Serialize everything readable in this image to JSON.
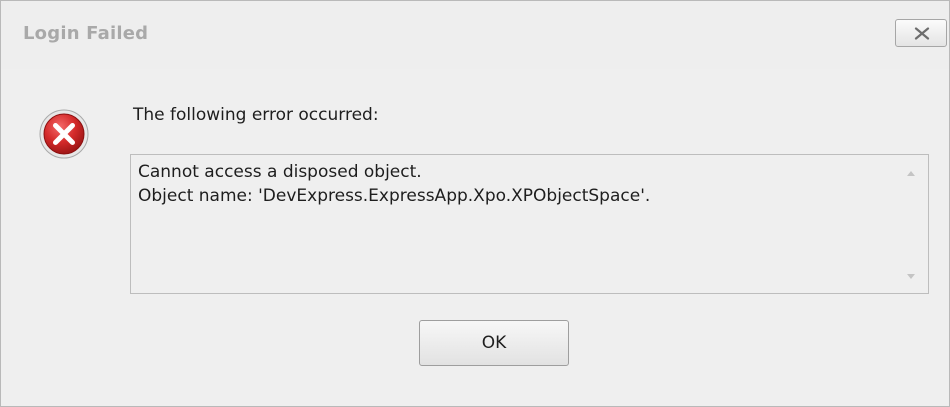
{
  "dialog": {
    "title": "Login Failed",
    "close_label": "x",
    "message": "The following error occurred:",
    "details": [
      "Cannot access a disposed object.",
      "Object name: 'DevExpress.ExpressApp.Xpo.XPObjectSpace'."
    ],
    "ok_label": "OK",
    "icon": "error-icon"
  },
  "colors": {
    "window_bg": "#efefef",
    "title_text": "#a9a9a9",
    "error_red": "#d42a2a"
  }
}
